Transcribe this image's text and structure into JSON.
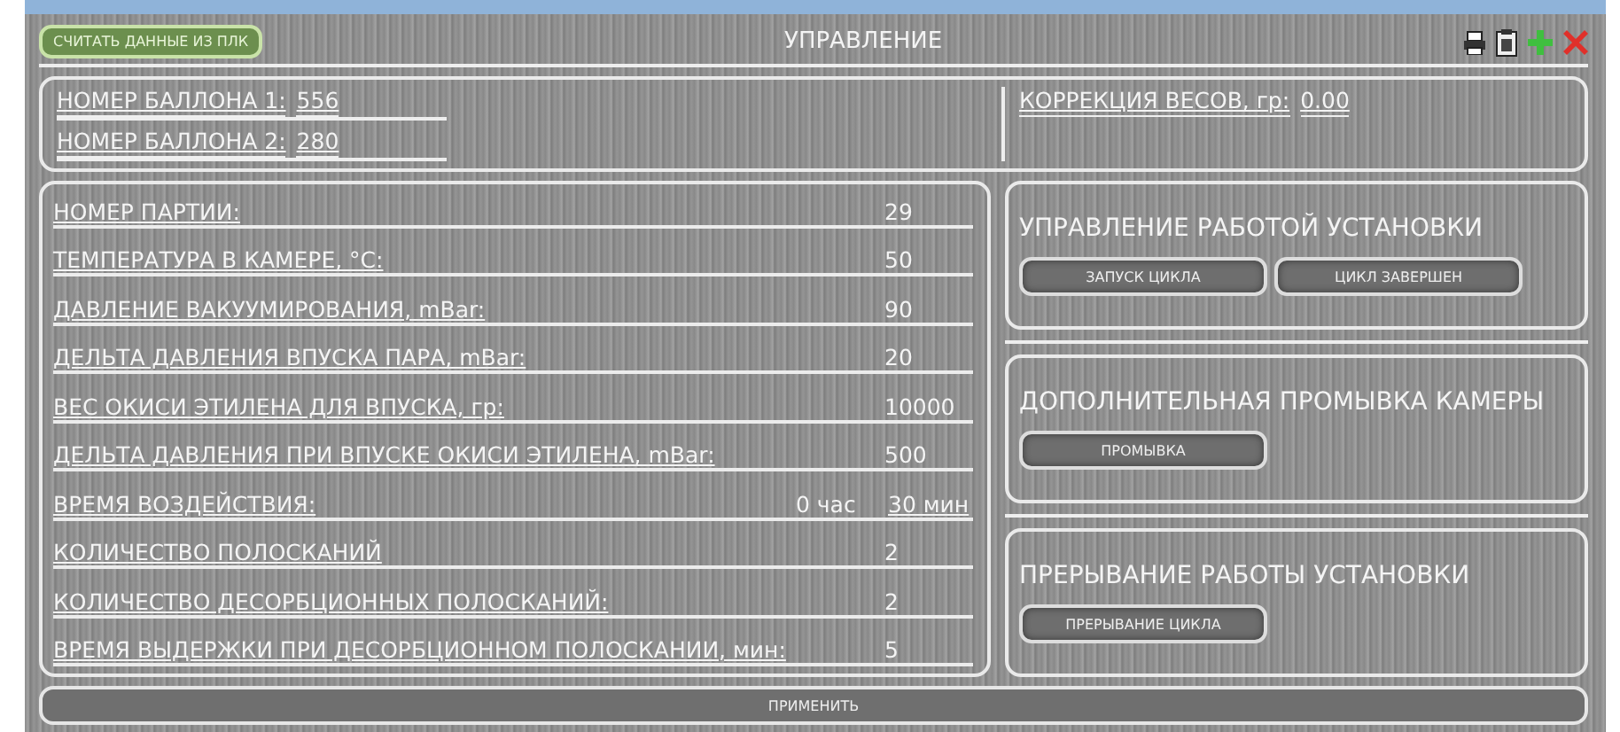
{
  "header": {
    "read_button": "СЧИТАТЬ ДАННЫЕ ИЗ ПЛК",
    "title": "УПРАВЛЕНИЕ"
  },
  "cylinders": [
    {
      "label": "НОМЕР БАЛЛОНА 1:",
      "value": "556"
    },
    {
      "label": "НОМЕР БАЛЛОНА 2:",
      "value": "280"
    }
  ],
  "weight_correction": {
    "label": "КОРРЕКЦИЯ ВЕСОВ, гр:",
    "value": "0.00"
  },
  "parameters": [
    {
      "label": "НОМЕР ПАРТИИ:",
      "values": [
        "29"
      ]
    },
    {
      "label": "ТЕМПЕРАТУРА В КАМЕРЕ, °С:",
      "values": [
        "50"
      ]
    },
    {
      "label": "ДАВЛЕНИЕ ВАКУУМИРОВАНИЯ, mBar:",
      "values": [
        "90"
      ]
    },
    {
      "label": "ДЕЛЬТА ДАВЛЕНИЯ ВПУСКА ПАРА, mBar:",
      "values": [
        "20"
      ]
    },
    {
      "label": "ВЕС ОКИСИ ЭТИЛЕНА ДЛЯ ВПУСКА, гр:",
      "values": [
        "10000"
      ]
    },
    {
      "label": "ДЕЛЬТА ДАВЛЕНИЯ ПРИ ВПУСКЕ ОКИСИ ЭТИЛЕНА, mBar:",
      "values": [
        "500"
      ]
    },
    {
      "label": "ВРЕМЯ ВОЗДЕЙСТВИЯ:",
      "values": [
        "0 час",
        "30 мин"
      ]
    },
    {
      "label": "КОЛИЧЕСТВО ПОЛОСКАНИЙ",
      "values": [
        "2"
      ]
    },
    {
      "label": "КОЛИЧЕСТВО ДЕСОРБЦИОННЫХ ПОЛОСКАНИЙ:",
      "values": [
        "2"
      ]
    },
    {
      "label": "ВРЕМЯ ВЫДЕРЖКИ ПРИ ДЕСОРБЦИОННОМ ПОЛОСКАНИИ, мин:",
      "values": [
        "5"
      ]
    }
  ],
  "control_panels": [
    {
      "title": "УПРАВЛЕНИЕ РАБОТОЙ УСТАНОВКИ",
      "buttons": [
        "ЗАПУСК ЦИКЛА",
        "ЦИКЛ ЗАВЕРШЕН"
      ]
    },
    {
      "title": "ДОПОЛНИТЕЛЬНАЯ ПРОМЫВКА КАМЕРЫ",
      "buttons": [
        "ПРОМЫВКА"
      ]
    },
    {
      "title": "ПРЕРЫВАНИЕ РАБОТЫ УСТАНОВКИ",
      "buttons": [
        "ПРЕРЫВАНИЕ ЦИКЛА"
      ]
    }
  ],
  "apply_button": "ПРИМЕНИТЬ"
}
